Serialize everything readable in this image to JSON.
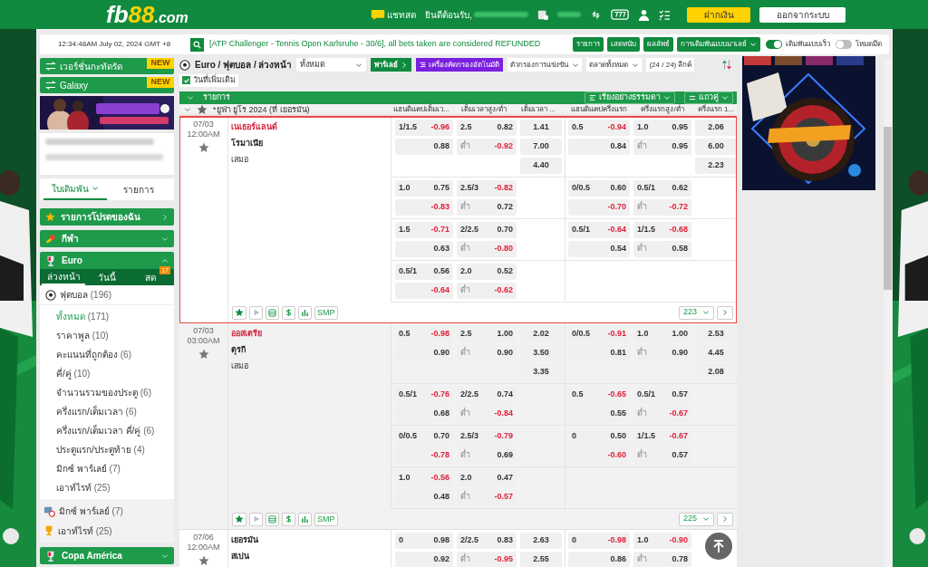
{
  "header": {
    "logo": [
      "fb",
      "88",
      ".com"
    ],
    "chat": "แชทสด",
    "welcome": "ยินดีต้อนรับ,",
    "deposit": "ฝากเงิน",
    "logout": "ออกจากระบบ"
  },
  "ticker": {
    "time": "12:34:48AM July 02, 2024 GMT +8",
    "message": "[ATP Challenger - Tennis Open Karlsruhe - 30/6], all bets taken are considered REFUNDED",
    "buttons": [
      "รายการ",
      "เสดหนับ",
      "ผลลัพธ์"
    ],
    "odds_type": "การเดิมพันแบบมาเลย์",
    "toggles": [
      {
        "label": "เดิมพันแบบเร็ว",
        "on": true
      },
      {
        "label": "โหมดมืด",
        "on": false
      }
    ]
  },
  "sidebar": {
    "banners": [
      {
        "label": "เวอร์ชั่นกะทัดรัด",
        "badge": "NEW"
      },
      {
        "label": "Galaxy",
        "badge": "NEW"
      }
    ],
    "tabs": [
      {
        "label": "ใบเดิมพัน",
        "selected": true
      },
      {
        "label": "รายการ",
        "selected": false
      }
    ],
    "sections": [
      {
        "kind": "link",
        "label": "รายการโปรดของฉัน"
      },
      {
        "kind": "group",
        "label": "กีฬา",
        "expanded": false
      },
      {
        "kind": "group",
        "label": "Euro",
        "expanded": true,
        "subtabs": [
          {
            "label": "ล่วงหน้า",
            "selected": true
          },
          {
            "label": "วันนี้",
            "selected": false
          },
          {
            "label": "สด",
            "selected": false,
            "badge": "17"
          }
        ],
        "sports": [
          {
            "label": "ฟุตบอล",
            "count": "(196)",
            "children": [
              {
                "label": "ทั้งหมด",
                "count": "(171)",
                "selected": true
              },
              {
                "label": "ราคาพูล",
                "count": "(10)",
                "selected": false
              },
              {
                "label": "คะแนนที่ถูกต้อง",
                "count": "(6)",
                "selected": false
              },
              {
                "label": "คี่/คู่",
                "count": "(10)",
                "selected": false
              },
              {
                "label": "จำนวนรวมของประตู",
                "count": "(6)",
                "selected": false
              },
              {
                "label": "ครึ่งแรก/เต็มเวลา",
                "count": "(6)",
                "selected": false
              },
              {
                "label": "ครึ่งแรก/เต็มเวลา คี่/คู่",
                "count": "(6)",
                "selected": false
              },
              {
                "label": "ประตูแรก/ประตูท้าย",
                "count": "(4)",
                "selected": false
              },
              {
                "label": "มิกซ์ พาร์เลย์",
                "count": "(7)",
                "selected": false
              },
              {
                "label": "เอาท์ไรท์",
                "count": "(25)",
                "selected": false
              }
            ]
          }
        ],
        "extras": [
          {
            "label": "มิกซ์ พาร์เลย์",
            "count": "(7)"
          },
          {
            "label": "เอาท์ไรท์",
            "count": "(25)"
          }
        ]
      },
      {
        "kind": "group",
        "label": "Copa América",
        "expanded": false
      }
    ]
  },
  "content": {
    "breadcrumb": "Euro / ฟุตบอล / ล่วงหน้า",
    "select": "ทั้งหมด",
    "parlay": "พาร์เลย์",
    "auto_filter": "เครื่องคัดกรองอัตโนมัติ",
    "filters": [
      "ตัวกรองการแข่งขัน",
      "ตลาดทั้งหมด"
    ],
    "league_count": "(24 / 24) ลีกค์",
    "more_dates": {
      "label": "วันที่เพิ่มเติม",
      "checked": true
    },
    "table": {
      "title": "รายการ",
      "sort": "เรียงอย่างธรรมดา",
      "view": "แถวคู่",
      "league": "*ยูฟ่า ยูโร 2024 (ที่ เยอรมัน)",
      "columns": [
        "แฮนดิแคปเต็มเว...",
        "เต็มเวลาสูง/ต่ำ",
        "เต็มเวลา ...",
        "แฮนดิแคปครึ่งแรก",
        "ครึ่งแรกสูง/ต่ำ",
        "ครึ่งแรก 1..."
      ],
      "matches": [
        {
          "date": "07/03",
          "time": "12:00AM",
          "selected": true,
          "teams": [
            {
              "name": "เนเธอร์แลนด์",
              "highlighted": true
            },
            {
              "name": "โรมาเนีย",
              "highlighted": false
            }
          ],
          "draw": "เสมอ",
          "lines": [
            {
              "ft_hdp": {
                "line": "1/1.5",
                "home": "-0.96",
                "away": "0.88"
              },
              "ft_ou": {
                "line": "2.5",
                "over": "0.82",
                "under_label": "ต่ำ",
                "under": "-0.92"
              },
              "ft_1x2": [
                "1.41",
                "7.00",
                "4.40"
              ],
              "ht_hdp": {
                "line": "0.5",
                "home": "-0.94",
                "away": "0.84"
              },
              "ht_ou": {
                "line": "1.0",
                "over": "0.95",
                "under_label": "ต่ำ",
                "under": "0.95"
              },
              "ht_1x2": [
                "2.06",
                "6.00",
                "2.23"
              ]
            },
            {
              "ft_hdp": {
                "line": "1.0",
                "home": "0.75",
                "away": "-0.83"
              },
              "ft_ou": {
                "line": "2.5/3",
                "over": "-0.82",
                "under_label": "ต่ำ",
                "under": "0.72"
              },
              "ht_hdp": {
                "line": "0/0.5",
                "home": "0.60",
                "away": "-0.70"
              },
              "ht_ou": {
                "line": "0.5/1",
                "over": "0.62",
                "under_label": "ต่ำ",
                "under": "-0.72"
              }
            },
            {
              "ft_hdp": {
                "line": "1.5",
                "home": "-0.71",
                "away": "0.63"
              },
              "ft_ou": {
                "line": "2/2.5",
                "over": "0.70",
                "under_label": "ต่ำ",
                "under": "-0.80"
              },
              "ht_hdp": {
                "line": "0.5/1",
                "home": "-0.64",
                "away": "0.54"
              },
              "ht_ou": {
                "line": "1/1.5",
                "over": "-0.68",
                "under_label": "ต่ำ",
                "under": "0.58"
              }
            },
            {
              "ft_hdp": {
                "line": "0.5/1",
                "home": "0.56",
                "away": "-0.64"
              },
              "ft_ou": {
                "line": "2.0",
                "over": "0.52",
                "under_label": "ต่ำ",
                "under": "-0.62"
              }
            }
          ],
          "smp": "SMP",
          "more_count": "223"
        },
        {
          "date": "07/03",
          "time": "03:00AM",
          "selected": false,
          "teams": [
            {
              "name": "ออสเตรีย",
              "highlighted": true
            },
            {
              "name": "ตุรกี",
              "highlighted": false
            }
          ],
          "draw": "เสมอ",
          "lines": [
            {
              "ft_hdp": {
                "line": "0.5",
                "home": "-0.98",
                "away": "0.90"
              },
              "ft_ou": {
                "line": "2.5",
                "over": "1.00",
                "under_label": "ต่ำ",
                "under": "0.90"
              },
              "ft_1x2": [
                "2.02",
                "3.50",
                "3.35"
              ],
              "ht_hdp": {
                "line": "0/0.5",
                "home": "-0.91",
                "away": "0.81"
              },
              "ht_ou": {
                "line": "1.0",
                "over": "1.00",
                "under_label": "ต่ำ",
                "under": "0.90"
              },
              "ht_1x2": [
                "2.53",
                "4.45",
                "2.08"
              ]
            },
            {
              "ft_hdp": {
                "line": "0.5/1",
                "home": "-0.76",
                "away": "0.68"
              },
              "ft_ou": {
                "line": "2/2.5",
                "over": "0.74",
                "under_label": "ต่ำ",
                "under": "-0.84"
              },
              "ht_hdp": {
                "line": "0.5",
                "home": "-0.65",
                "away": "0.55"
              },
              "ht_ou": {
                "line": "0.5/1",
                "over": "0.57",
                "under_label": "ต่ำ",
                "under": "-0.67"
              }
            },
            {
              "ft_hdp": {
                "line": "0/0.5",
                "home": "0.70",
                "away": "-0.78"
              },
              "ft_ou": {
                "line": "2.5/3",
                "over": "-0.79",
                "under_label": "ต่ำ",
                "under": "0.69"
              },
              "ht_hdp": {
                "line": "0",
                "home": "0.50",
                "away": "-0.60"
              },
              "ht_ou": {
                "line": "1/1.5",
                "over": "-0.67",
                "under_label": "ต่ำ",
                "under": "0.57"
              }
            },
            {
              "ft_hdp": {
                "line": "1.0",
                "home": "-0.56",
                "away": "0.48"
              },
              "ft_ou": {
                "line": "2.0",
                "over": "0.47",
                "under_label": "ต่ำ",
                "under": "-0.57"
              }
            }
          ],
          "smp": "SMP",
          "more_count": "225"
        },
        {
          "date": "07/06",
          "time": "12:00AM",
          "selected": false,
          "teams": [
            {
              "name": "เยอรมัน",
              "highlighted": false
            },
            {
              "name": "สเปน",
              "highlighted": false
            }
          ],
          "lines": [
            {
              "ft_hdp": {
                "line": "0",
                "home": "0.98",
                "away": "0.92"
              },
              "ft_ou": {
                "line": "2/2.5",
                "over": "0.83",
                "under_label": "ต่ำ",
                "under": "-0.95"
              },
              "ft_1x2": [
                "2.63",
                "2.55"
              ],
              "ht_hdp": {
                "line": "0",
                "home": "-0.98",
                "away": "0.86"
              },
              "ht_ou": {
                "line": "1.0",
                "over": "-0.90",
                "under_label": "ต่ำ",
                "under": "0.78"
              }
            }
          ]
        }
      ]
    }
  }
}
